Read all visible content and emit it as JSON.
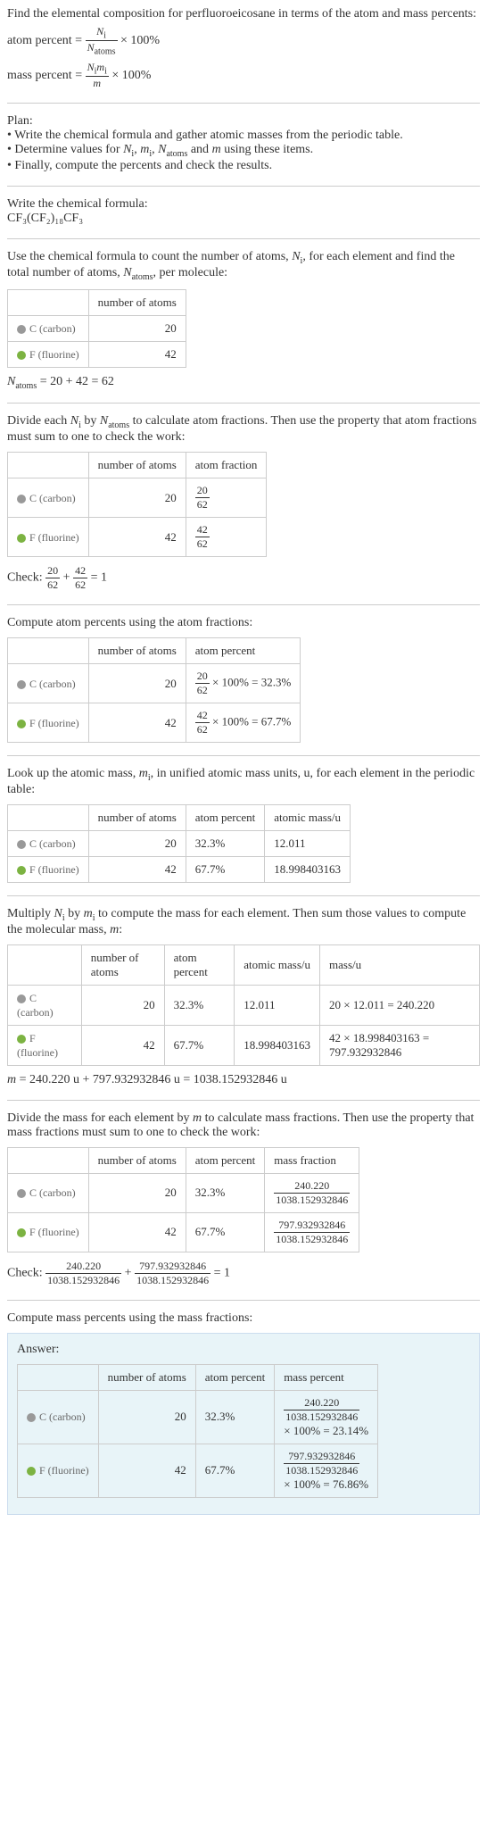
{
  "intro": {
    "line1": "Find the elemental composition for perfluoroeicosane in terms of the atom and mass percents:",
    "atom_percent_lhs": "atom percent =",
    "atom_percent_frac_num": "N_i",
    "atom_percent_frac_den": "N_atoms",
    "times100": "× 100%",
    "mass_percent_lhs": "mass percent =",
    "mass_percent_frac_num": "N_i m_i",
    "mass_percent_frac_den": "m"
  },
  "plan": {
    "title": "Plan:",
    "b1": "• Write the chemical formula and gather atomic masses from the periodic table.",
    "b2_pre": "• Determine values for ",
    "b2_vars": "N_i, m_i, N_atoms and m",
    "b2_post": " using these items.",
    "b3": "• Finally, compute the percents and check the results."
  },
  "formula": {
    "title": "Write the chemical formula:",
    "text": "CF₃(CF₂)₁₈CF₃"
  },
  "count": {
    "intro_pre": "Use the chemical formula to count the number of atoms, ",
    "intro_var1": "N_i",
    "intro_mid": ", for each element and find the total number of atoms, ",
    "intro_var2": "N_atoms",
    "intro_post": ", per molecule:",
    "h_num": "number of atoms",
    "c_label": "C (carbon)",
    "c_val": "20",
    "f_label": "F (fluorine)",
    "f_val": "42",
    "sum": "N_atoms = 20 + 42 = 62"
  },
  "atomfrac": {
    "intro_pre": "Divide each ",
    "intro_v1": "N_i",
    "intro_mid": " by ",
    "intro_v2": "N_atoms",
    "intro_post": " to calculate atom fractions. Then use the property that atom fractions must sum to one to check the work:",
    "h_num": "number of atoms",
    "h_frac": "atom fraction",
    "c_val": "20",
    "c_frac_num": "20",
    "c_frac_den": "62",
    "f_val": "42",
    "f_frac_num": "42",
    "f_frac_den": "62",
    "check_pre": "Check: ",
    "check_f1_num": "20",
    "check_f1_den": "62",
    "check_plus": " + ",
    "check_f2_num": "42",
    "check_f2_den": "62",
    "check_eq": " = 1"
  },
  "atompct": {
    "intro": "Compute atom percents using the atom fractions:",
    "h_num": "number of atoms",
    "h_pct": "atom percent",
    "c_val": "20",
    "c_frac_num": "20",
    "c_frac_den": "62",
    "c_pct": " × 100% = 32.3%",
    "f_val": "42",
    "f_frac_num": "42",
    "f_frac_den": "62",
    "f_pct": " × 100% = 67.7%"
  },
  "atomicmass": {
    "intro_pre": "Look up the atomic mass, ",
    "intro_var": "m_i",
    "intro_post": ", in unified atomic mass units, u, for each element in the periodic table:",
    "h_num": "number of atoms",
    "h_pct": "atom percent",
    "h_mass": "atomic mass/u",
    "c_num": "20",
    "c_pct": "32.3%",
    "c_mass": "12.011",
    "f_num": "42",
    "f_pct": "67.7%",
    "f_mass": "18.998403163"
  },
  "massmult": {
    "intro_pre": "Multiply ",
    "intro_v1": "N_i",
    "intro_mid": " by ",
    "intro_v2": "m_i",
    "intro_post": " to compute the mass for each element. Then sum those values to compute the molecular mass, ",
    "intro_v3": "m",
    "intro_colon": ":",
    "h_num": "number of atoms",
    "h_pct": "atom percent",
    "h_amass": "atomic mass/u",
    "h_mass": "mass/u",
    "c_num": "20",
    "c_pct": "32.3%",
    "c_amass": "12.011",
    "c_mass": "20 × 12.011 = 240.220",
    "f_num": "42",
    "f_pct": "67.7%",
    "f_amass": "18.998403163",
    "f_mass": "42 × 18.998403163 = 797.932932846",
    "sum": "m = 240.220 u + 797.932932846 u = 1038.152932846 u"
  },
  "massfrac": {
    "intro_pre": "Divide the mass for each element by ",
    "intro_var": "m",
    "intro_post": " to calculate mass fractions. Then use the property that mass fractions must sum to one to check the work:",
    "h_num": "number of atoms",
    "h_pct": "atom percent",
    "h_frac": "mass fraction",
    "c_num": "20",
    "c_pct": "32.3%",
    "c_frac_num": "240.220",
    "c_frac_den": "1038.152932846",
    "f_num": "42",
    "f_pct": "67.7%",
    "f_frac_num": "797.932932846",
    "f_frac_den": "1038.152932846",
    "check_pre": "Check: ",
    "check_f1_num": "240.220",
    "check_f1_den": "1038.152932846",
    "check_plus": " + ",
    "check_f2_num": "797.932932846",
    "check_f2_den": "1038.152932846",
    "check_eq": " = 1"
  },
  "masspct": {
    "intro": "Compute mass percents using the mass fractions:",
    "answer": "Answer:",
    "h_num": "number of atoms",
    "h_pct": "atom percent",
    "h_mpct": "mass percent",
    "c_num": "20",
    "c_pct": "32.3%",
    "c_frac_num": "240.220",
    "c_frac_den": "1038.152932846",
    "c_res": "× 100% = 23.14%",
    "f_num": "42",
    "f_pct": "67.7%",
    "f_frac_num": "797.932932846",
    "f_frac_den": "1038.152932846",
    "f_res": "× 100% = 76.86%"
  },
  "labels": {
    "c": "C (carbon)",
    "f": "F (fluorine)"
  }
}
